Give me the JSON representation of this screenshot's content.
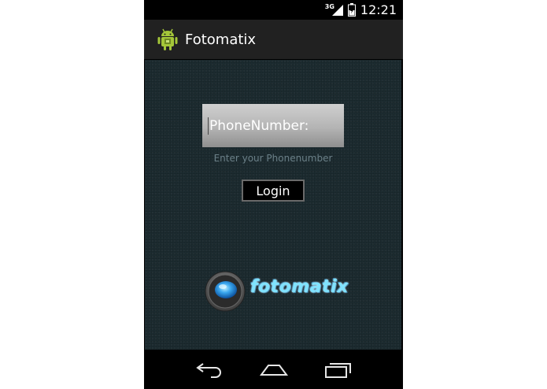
{
  "status_bar": {
    "network_label": "3G",
    "time": "12:21"
  },
  "action_bar": {
    "app_icon": "android-icon",
    "title": "Fotomatix"
  },
  "login_form": {
    "phone_input_text": "PhoneNumber:",
    "hint": "Enter your Phonenumber",
    "login_label": "Login"
  },
  "logo": {
    "text": "fotomatix",
    "icon": "camera-lens-icon"
  },
  "nav_bar": {
    "back_icon": "back-icon",
    "home_icon": "home-icon",
    "recent_icon": "recent-apps-icon"
  },
  "colors": {
    "action_bar": "#212121",
    "content_bg": "#1c2b30",
    "hint_text": "#6b8088",
    "logo_text": "#7fe3ff"
  }
}
